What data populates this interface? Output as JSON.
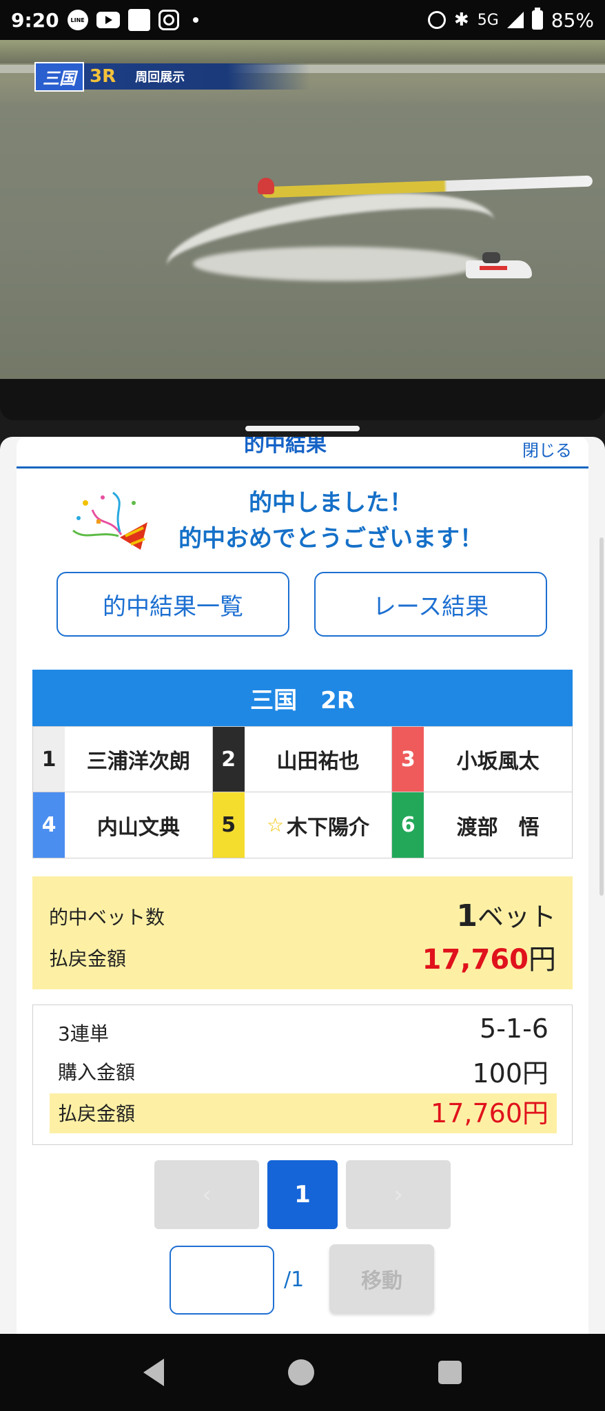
{
  "status_bar": {
    "time": "9:20",
    "network": "5G",
    "battery": "85%",
    "icons": [
      "line-icon",
      "youtube-icon",
      "app-icon",
      "instagram-icon",
      "alarm-icon",
      "bluetooth-icon",
      "signal-icon",
      "battery-icon"
    ]
  },
  "video": {
    "venue_logo": "三国",
    "race": "3R",
    "label": "周回展示"
  },
  "sheet": {
    "title": "的中結果",
    "close_label": "閉じる",
    "message_line1": "的中しました！",
    "message_line2": "的中おめでとうございます！",
    "button_hit_list": "的中結果一覧",
    "button_race_result": "レース結果"
  },
  "race": {
    "header": "三国　2R",
    "racers": [
      {
        "num": "1",
        "name": "三浦洋次朗",
        "color": "#eeeeee",
        "text_color": "#222222",
        "star": false
      },
      {
        "num": "2",
        "name": "山田祐也",
        "color": "#2b2b2b",
        "text_color": "#ffffff",
        "star": false
      },
      {
        "num": "3",
        "name": "小坂風太",
        "color": "#ef5b5b",
        "text_color": "#ffffff",
        "star": false
      },
      {
        "num": "4",
        "name": "内山文典",
        "color": "#4a8ef0",
        "text_color": "#ffffff",
        "star": false
      },
      {
        "num": "5",
        "name": "木下陽介",
        "color": "#f5dd2e",
        "text_color": "#222222",
        "star": true
      },
      {
        "num": "6",
        "name": "渡部　悟",
        "color": "#23a85a",
        "text_color": "#ffffff",
        "star": false
      }
    ]
  },
  "summary": {
    "bets_label": "的中ベット数",
    "bets_value_num": "1",
    "bets_value_unit": "ベット",
    "payout_label": "払戻金額",
    "payout_value": "17,760",
    "payout_unit": "円"
  },
  "detail": {
    "type_label": "3連単",
    "combination": "5-1-6",
    "purchase_label": "購入金額",
    "purchase_value": "100円",
    "payout_label": "払戻金額",
    "payout_value": "17,760円"
  },
  "pager": {
    "prev": "‹",
    "current": "1",
    "next": "›",
    "input_value": "",
    "total": "/1",
    "move_label": "移動"
  }
}
